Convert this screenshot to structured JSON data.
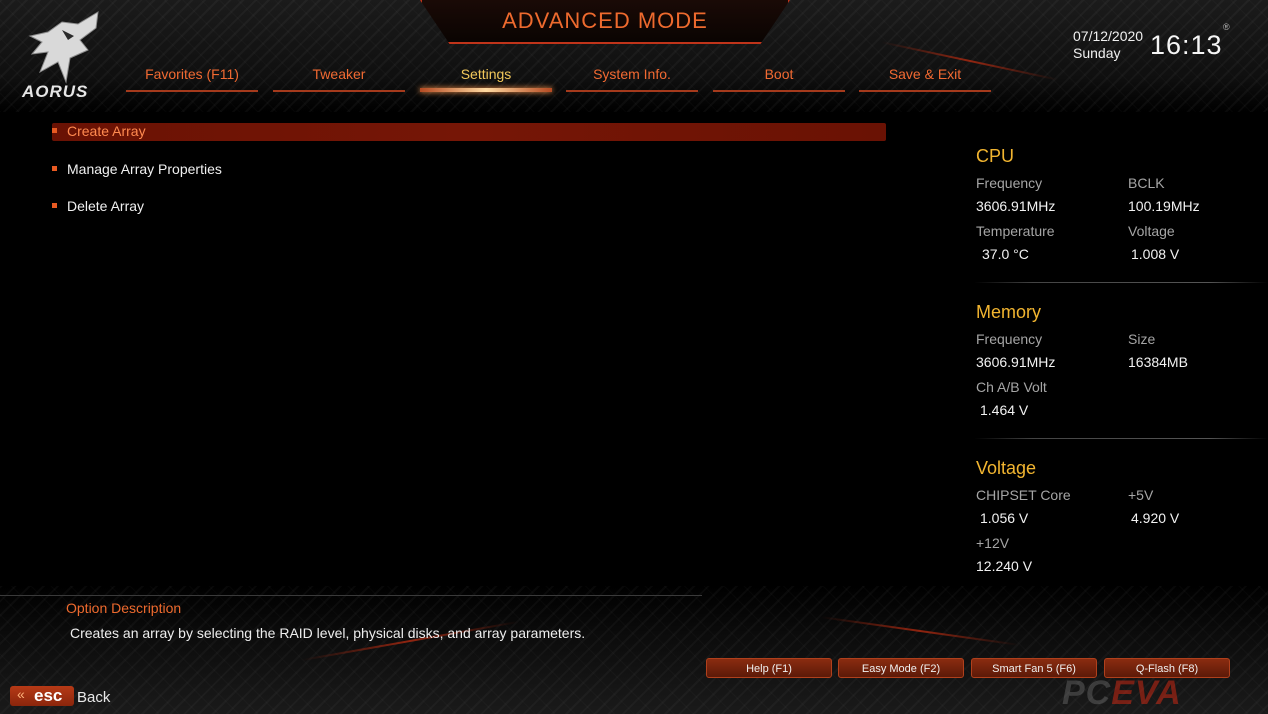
{
  "header": {
    "mode_title": "ADVANCED MODE",
    "logo_text": "AORUS",
    "date": "07/12/2020",
    "day": "Sunday",
    "time": "16:13",
    "registered_mark": "®"
  },
  "tabs": [
    {
      "label": "Favorites (F11)",
      "active": false
    },
    {
      "label": "Tweaker",
      "active": false
    },
    {
      "label": "Settings",
      "active": true
    },
    {
      "label": "System Info.",
      "active": false
    },
    {
      "label": "Boot",
      "active": false
    },
    {
      "label": "Save & Exit",
      "active": false
    }
  ],
  "menu": [
    {
      "label": "Create Array",
      "selected": true
    },
    {
      "label": "Manage Array Properties",
      "selected": false
    },
    {
      "label": "Delete Array",
      "selected": false
    }
  ],
  "cpu": {
    "title": "CPU",
    "freq_label": "Frequency",
    "freq_value": "3606.91MHz",
    "bclk_label": "BCLK",
    "bclk_value": "100.19MHz",
    "temp_label": "Temperature",
    "temp_value": "37.0 °C",
    "volt_label": "Voltage",
    "volt_value": "1.008 V"
  },
  "memory": {
    "title": "Memory",
    "freq_label": "Frequency",
    "freq_value": "3606.91MHz",
    "size_label": "Size",
    "size_value": "16384MB",
    "chvolt_label": "Ch A/B Volt",
    "chvolt_value": "1.464 V"
  },
  "voltage": {
    "title": "Voltage",
    "chipset_label": "CHIPSET Core",
    "chipset_value": "1.056 V",
    "v5_label": "+5V",
    "v5_value": "4.920 V",
    "v12_label": "+12V",
    "v12_value": "12.240 V"
  },
  "description": {
    "title": "Option Description",
    "text": "Creates an array by selecting the RAID level, physical disks, and array parameters."
  },
  "footer": {
    "buttons": [
      "Help (F1)",
      "Easy Mode (F2)",
      "Smart Fan 5 (F6)",
      "Q-Flash (F8)"
    ],
    "esc_label": "esc",
    "esc_arrows": "«",
    "back_label": "Back"
  },
  "watermark": {
    "prefix": "PC",
    "highlight": "EVA"
  },
  "colors": {
    "accent": "#ee6a2e",
    "active_tab": "#f2c85b",
    "section_heading": "#f2b530",
    "selection": "#761606"
  },
  "icons": [
    "aorus-eagle-logo",
    "menu-bullet-icon",
    "esc-arrows-icon"
  ]
}
